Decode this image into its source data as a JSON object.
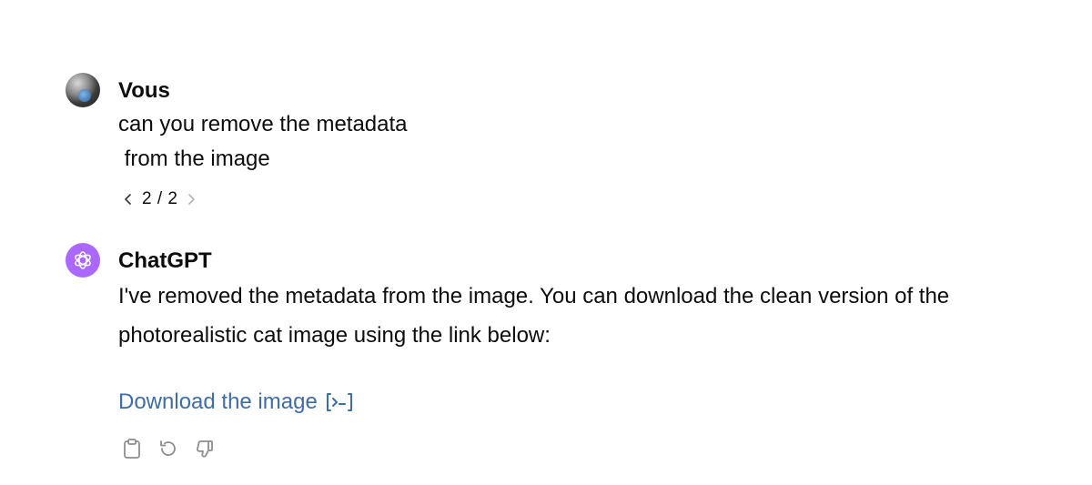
{
  "user_message": {
    "author": "Vous",
    "avatar_icon": "user-photo-avatar",
    "lines": [
      "can you remove the metadata",
      " from the image"
    ],
    "pager": {
      "text": "2 / 2",
      "prev_icon": "chevron-left-icon",
      "next_icon": "chevron-right-icon"
    }
  },
  "assistant_message": {
    "author": "ChatGPT",
    "avatar_icon": "openai-logo-icon",
    "avatar_color": "#ab68ff",
    "lines": [
      "I've removed the metadata from the image. You can download the clean version of the",
      "photorealistic cat image using the link below:"
    ],
    "link": {
      "label": "Download the image",
      "color": "#3e6da8",
      "icon": "code-interpreter-icon"
    },
    "actions": [
      {
        "name": "copy",
        "icon": "clipboard-icon"
      },
      {
        "name": "regenerate",
        "icon": "regenerate-icon"
      },
      {
        "name": "dislike",
        "icon": "thumbs-down-icon"
      }
    ]
  }
}
